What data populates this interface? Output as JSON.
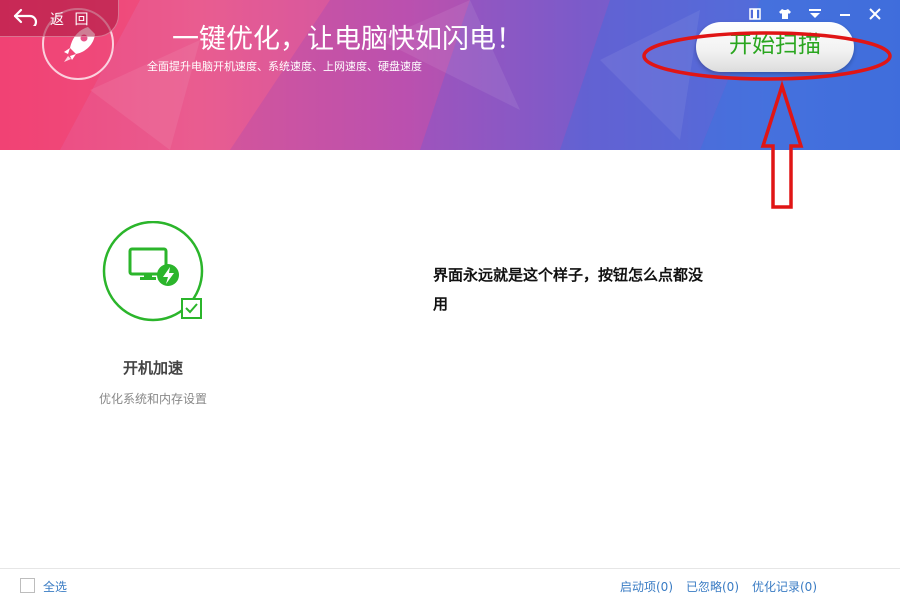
{
  "header": {
    "back_label": "返 回",
    "headline": "一键优化，让电脑快如闪电！",
    "subline": "全面提升电脑开机速度、系统速度、上网速度、硬盘速度",
    "scan_button": "开始扫描"
  },
  "window_controls": [
    "film-icon",
    "shirt-icon",
    "menu-icon",
    "minimize-icon",
    "close-icon"
  ],
  "feature": {
    "title": "开机加速",
    "description": "优化系统和内存设置",
    "icon": "monitor-bolt-icon",
    "accent": "#2bb52b"
  },
  "annotation": {
    "text": "界面永远就是这个样子，按钮怎么点都没用",
    "color": "#e01515"
  },
  "footer": {
    "select_all": "全选",
    "links": [
      "启动项(0)",
      "已忽略(0)",
      "优化记录(0)"
    ]
  }
}
